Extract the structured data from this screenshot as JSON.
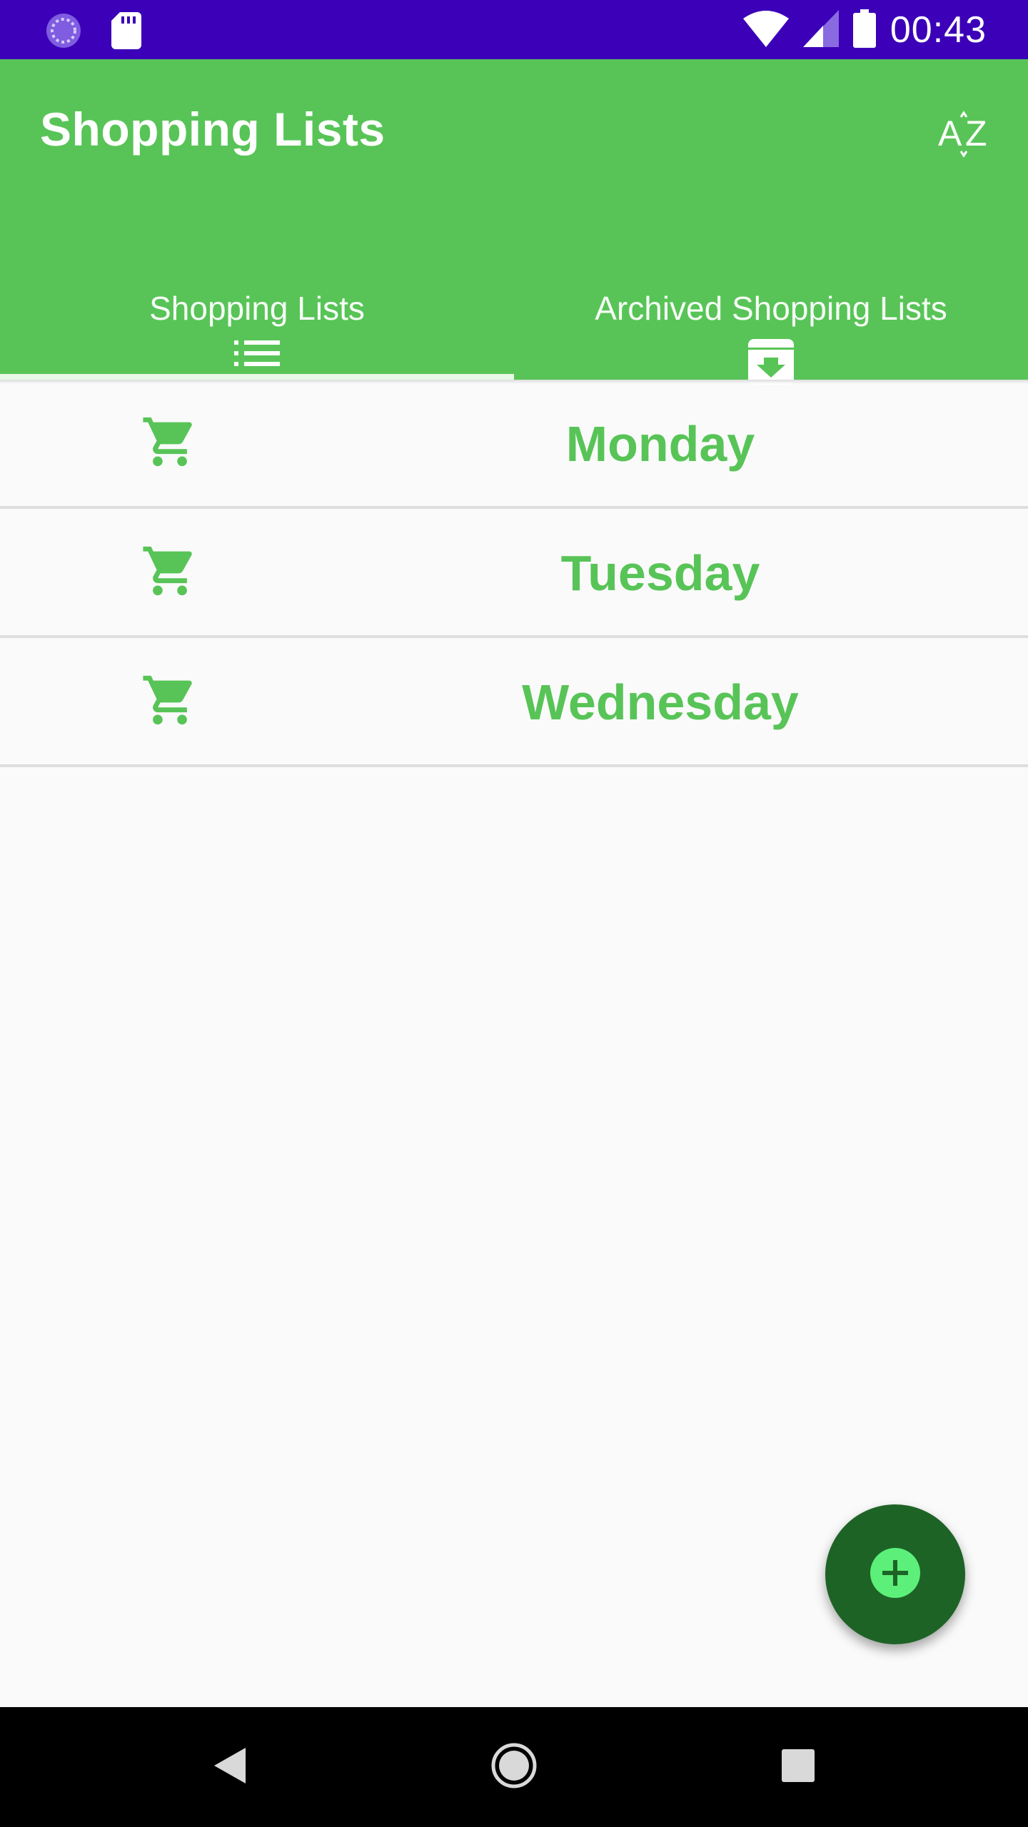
{
  "status_bar": {
    "time": "00:43",
    "icons": [
      "loading-icon",
      "sd-card-icon",
      "wifi-icon",
      "cell-signal-icon",
      "battery-icon"
    ],
    "color": "#3b00b8"
  },
  "app_bar": {
    "title": "Shopping Lists",
    "sort_icon": "sort-alpha-icon",
    "color": "#58c457"
  },
  "tabs": [
    {
      "label": "Shopping Lists",
      "icon": "list-icon",
      "selected": true
    },
    {
      "label": "Archived Shopping Lists",
      "icon": "archive-icon",
      "selected": false
    }
  ],
  "lists": [
    {
      "name": "Monday",
      "icon": "cart-icon"
    },
    {
      "name": "Tuesday",
      "icon": "cart-icon"
    },
    {
      "name": "Wednesday",
      "icon": "cart-icon"
    }
  ],
  "fab": {
    "icon": "add-icon",
    "color": "#1e6326",
    "icon_color": "#5cf07a"
  },
  "nav_bar": {
    "buttons": [
      "back-icon",
      "home-icon",
      "recents-icon"
    ]
  }
}
